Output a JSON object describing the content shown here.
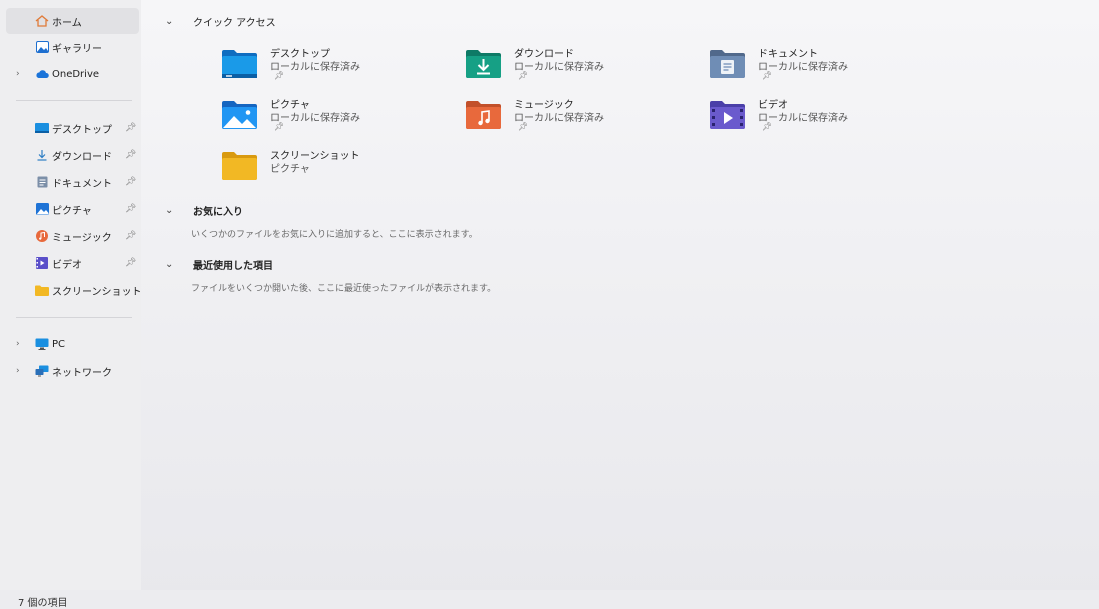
{
  "sidebar": {
    "items": [
      {
        "label": "ホーム",
        "icon": "home-icon"
      },
      {
        "label": "ギャラリー",
        "icon": "gallery-icon"
      },
      {
        "label": "OneDrive",
        "icon": "onedrive-cloud-icon"
      },
      {
        "label": "デスクトップ",
        "icon": "desktop-icon"
      },
      {
        "label": "ダウンロード",
        "icon": "download-icon"
      },
      {
        "label": "ドキュメント",
        "icon": "documents-icon"
      },
      {
        "label": "ピクチャ",
        "icon": "pictures-icon"
      },
      {
        "label": "ミュージック",
        "icon": "music-icon"
      },
      {
        "label": "ビデオ",
        "icon": "videos-icon"
      },
      {
        "label": "スクリーンショット",
        "icon": "folder-icon"
      },
      {
        "label": "PC",
        "icon": "pc-icon"
      },
      {
        "label": "ネットワーク",
        "icon": "network-icon"
      }
    ]
  },
  "quick_access": {
    "title": "クイック アクセス",
    "tiles": [
      {
        "name": "デスクトップ",
        "sub": "ローカルに保存済み",
        "icon": "desktop-folder-icon"
      },
      {
        "name": "ダウンロード",
        "sub": "ローカルに保存済み",
        "icon": "download-folder-icon"
      },
      {
        "name": "ドキュメント",
        "sub": "ローカルに保存済み",
        "icon": "documents-folder-icon"
      },
      {
        "name": "ピクチャ",
        "sub": "ローカルに保存済み",
        "icon": "pictures-folder-icon"
      },
      {
        "name": "ミュージック",
        "sub": "ローカルに保存済み",
        "icon": "music-folder-icon"
      },
      {
        "name": "ビデオ",
        "sub": "ローカルに保存済み",
        "icon": "videos-folder-icon"
      },
      {
        "name": "スクリーンショット",
        "sub": "ピクチャ",
        "icon": "screenshots-folder-icon"
      }
    ]
  },
  "favorites": {
    "title": "お気に入り",
    "message": "いくつかのファイルをお気に入りに追加すると、ここに表示されます。"
  },
  "recent": {
    "title": "最近使用した項目",
    "message": "ファイルをいくつか開いた後、ここに最近使ったファイルが表示されます。"
  },
  "status_bar": {
    "item_count": "7 個の項目"
  },
  "colors": {
    "desktop": "#1a8fe0",
    "download": "#16a085",
    "documents": "#6f8db5",
    "pictures": "#2196f3",
    "music": "#e8693c",
    "videos": "#6a5acd",
    "screenshots": "#f2b824"
  }
}
